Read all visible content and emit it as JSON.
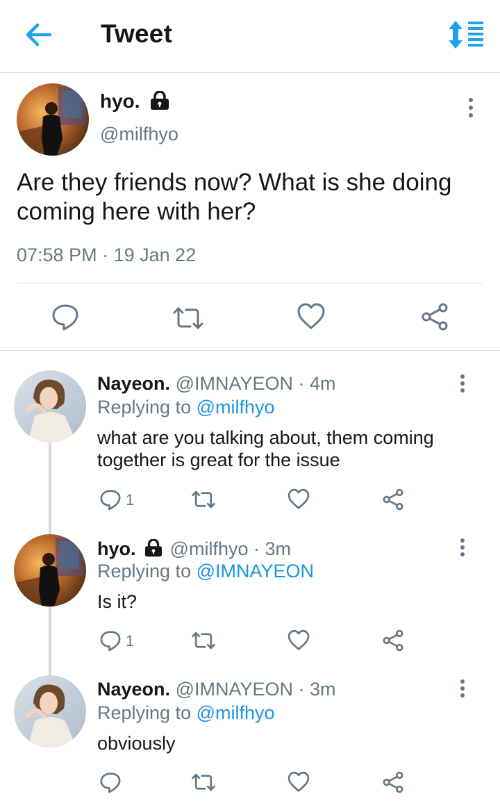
{
  "header": {
    "title": "Tweet",
    "back_icon": "arrow-left-icon",
    "sort_icon": "sort-icon"
  },
  "colors": {
    "accent": "#1da1f2",
    "text": "#14171a",
    "muted": "#657786",
    "divider": "#dcdfe2"
  },
  "main_tweet": {
    "name": "hyo.",
    "handle": "@milfhyo",
    "text": "Are they friends now? What is she doing coming here with her?",
    "time": "07:58 PM",
    "date": "19 Jan 22"
  },
  "replies": [
    {
      "name": "Nayeon.",
      "handle": "@IMNAYEON",
      "time": "4m",
      "replying_prefix": "Replying to",
      "replying_to": "@milfhyo",
      "text": "what are you talking about, them coming together is great for the issue",
      "reply_count": "1"
    },
    {
      "name": "hyo.",
      "handle": "@milfhyo",
      "time": "3m",
      "replying_prefix": "Replying to",
      "replying_to": "@IMNAYEON",
      "text": "Is it?",
      "reply_count": "1"
    },
    {
      "name": "Nayeon.",
      "handle": "@IMNAYEON",
      "time": "3m",
      "replying_prefix": "Replying to",
      "replying_to": "@milfhyo",
      "text": "obviously",
      "reply_count": ""
    }
  ]
}
